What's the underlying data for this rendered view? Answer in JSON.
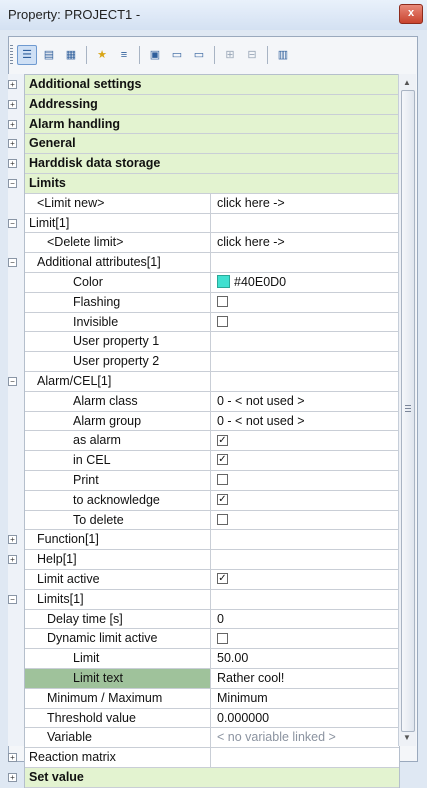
{
  "window": {
    "title": "Property: PROJECT1 -",
    "close_label": "x"
  },
  "toolbar": {
    "buttons": [
      {
        "icon": "categorized-view-icon",
        "glyph": "☰"
      },
      {
        "icon": "page-icon",
        "glyph": "▤"
      },
      {
        "icon": "grid-page-icon",
        "glyph": "▦"
      },
      {
        "icon": "favorite-star-icon",
        "glyph": "★"
      },
      {
        "icon": "list-icon",
        "glyph": "≡"
      },
      {
        "icon": "window-icon",
        "glyph": "▣"
      },
      {
        "icon": "panel-icon",
        "glyph": "▭"
      },
      {
        "icon": "frame-icon",
        "glyph": "▭"
      },
      {
        "icon": "expand-all-icon",
        "glyph": "⊞"
      },
      {
        "icon": "collapse-all-icon",
        "glyph": "⊟"
      },
      {
        "icon": "properties-icon",
        "glyph": "▥"
      }
    ]
  },
  "grid": {
    "rows": [
      {
        "name": "Additional settings",
        "type": "category",
        "expander": "+",
        "indent": 0
      },
      {
        "name": "Addressing",
        "type": "category",
        "expander": "+",
        "indent": 0
      },
      {
        "name": "Alarm handling",
        "type": "category",
        "expander": "+",
        "indent": 0
      },
      {
        "name": "General",
        "type": "category",
        "expander": "+",
        "indent": 0
      },
      {
        "name": "Harddisk data storage",
        "type": "category",
        "expander": "+",
        "indent": 0
      },
      {
        "name": "Limits",
        "type": "category",
        "expander": "−",
        "indent": 0
      },
      {
        "name": "<Limit new>",
        "value": "click here ->",
        "indent": 1
      },
      {
        "name": "Limit[1]",
        "value": "",
        "expander": "−",
        "indent": 0
      },
      {
        "name": "<Delete limit>",
        "value": "click here ->",
        "indent": 2
      },
      {
        "name": "Additional attributes[1]",
        "value": "",
        "expander": "−",
        "indent": 1
      },
      {
        "name": "Color",
        "value": "#40E0D0",
        "swatch": true,
        "indent": 3
      },
      {
        "name": "Flashing",
        "checkbox": false,
        "indent": 3
      },
      {
        "name": "Invisible",
        "checkbox": false,
        "indent": 3
      },
      {
        "name": "User property 1",
        "value": "",
        "indent": 3
      },
      {
        "name": "User property 2",
        "value": "",
        "indent": 3
      },
      {
        "name": "Alarm/CEL[1]",
        "value": "",
        "expander": "−",
        "indent": 1
      },
      {
        "name": "Alarm class",
        "value": "0 - < not used >",
        "indent": 3
      },
      {
        "name": "Alarm group",
        "value": "0 - < not used >",
        "indent": 3
      },
      {
        "name": "as alarm",
        "checkbox": true,
        "indent": 3
      },
      {
        "name": "in CEL",
        "checkbox": true,
        "indent": 3
      },
      {
        "name": "Print",
        "checkbox": false,
        "indent": 3
      },
      {
        "name": "to acknowledge",
        "checkbox": true,
        "indent": 3
      },
      {
        "name": "To delete",
        "checkbox": false,
        "indent": 3
      },
      {
        "name": "Function[1]",
        "value": "",
        "expander": "+",
        "indent": 1
      },
      {
        "name": "Help[1]",
        "value": "",
        "expander": "+",
        "indent": 1
      },
      {
        "name": "Limit active",
        "checkbox": true,
        "indent": 1
      },
      {
        "name": "Limits[1]",
        "value": "",
        "expander": "−",
        "indent": 1
      },
      {
        "name": "Delay time [s]",
        "value": "0",
        "indent": 2
      },
      {
        "name": "Dynamic limit active",
        "checkbox": false,
        "indent": 2
      },
      {
        "name": "Limit",
        "value": "50.00",
        "indent": 3
      },
      {
        "name": "Limit text",
        "value": "Rather cool!",
        "selected": true,
        "indent": 3
      },
      {
        "name": "Minimum / Maximum",
        "value": "Minimum",
        "indent": 2
      },
      {
        "name": "Threshold value",
        "value": "0.000000",
        "indent": 2
      },
      {
        "name": "Variable",
        "value": "< no variable linked >",
        "muted": true,
        "indent": 2
      },
      {
        "name": "Reaction matrix",
        "value": "",
        "expander": "+",
        "indent": 0
      },
      {
        "name": "Set value",
        "type": "category",
        "expander": "+",
        "indent": 0
      }
    ]
  },
  "colors": {
    "category_bg": "#e3f3d0",
    "selected_bg": "#9fc29b",
    "swatch": "#40E0D0"
  }
}
